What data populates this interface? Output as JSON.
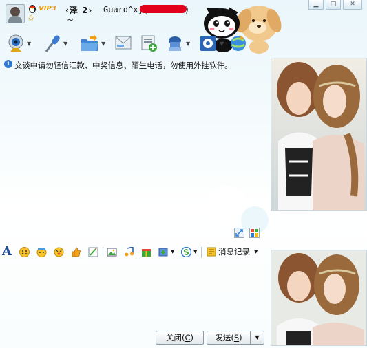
{
  "header": {
    "vip_label": "VIP3",
    "contact_name": "‹泽 2›",
    "contact_account": "Guard^xj(",
    "account_close": ")",
    "status_text": "~"
  },
  "toolbar": {
    "items": [
      {
        "name": "video-call",
        "icon": "webcam-icon",
        "has_menu": true
      },
      {
        "name": "voice-call",
        "icon": "microphone-icon",
        "has_menu": true
      },
      {
        "name": "send-file",
        "icon": "folder-icon",
        "has_menu": true
      },
      {
        "name": "send-sms",
        "icon": "sms-icon",
        "has_menu": false
      },
      {
        "name": "create-group",
        "icon": "group-add-icon",
        "has_menu": false
      },
      {
        "name": "remote-assist",
        "icon": "remote-icon",
        "has_menu": true
      },
      {
        "name": "apps",
        "icon": "apps-gear-icon",
        "has_menu": true
      },
      {
        "name": "more",
        "icon": "globe-icon",
        "has_menu": false
      }
    ]
  },
  "chat": {
    "notice": "交谈中请勿轻信汇款、中奖信息、陌生电话，勿使用外挂软件。"
  },
  "format_toolbar": {
    "font_label": "A",
    "message_log_label": "消息记录"
  },
  "buttons": {
    "close_label": "关闭(",
    "close_key": "C",
    "close_tail": ")",
    "send_label": "发送(",
    "send_key": "S",
    "send_tail": ")"
  },
  "colors": {
    "accent": "#2d7bd6",
    "redaction": "#e3001a",
    "vip": "#f49a00"
  }
}
